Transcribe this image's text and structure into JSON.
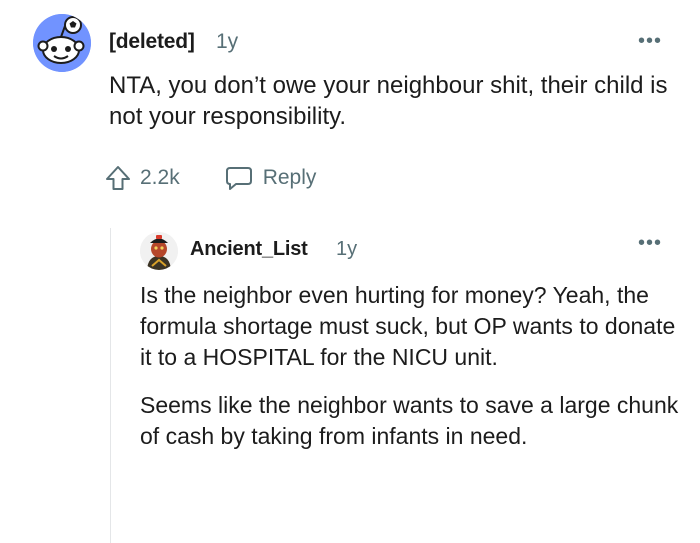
{
  "top_comment": {
    "username": "[deleted]",
    "age": "1y",
    "more_label": "•••",
    "body": "NTA, you don’t owe your neighbour shit, their child is not your responsibility.",
    "upvotes": "2.2k",
    "reply_label": "Reply"
  },
  "reply_comment": {
    "username": "Ancient_List",
    "age": "1y",
    "more_label": "•••",
    "paragraphs": [
      "Is the neighbor even hurting for money? Yeah, the formula shortage must suck, but OP wants to donate it to a HOSPITAL for the NICU unit.",
      "Seems like the neighbor wants to save a large chunk of cash by taking from infants in need."
    ]
  },
  "colors": {
    "text": "#1c1c1c",
    "meta": "#576f76",
    "default_avatar_bg": "#7193ff",
    "thread_line": "#e4e6e8"
  },
  "icons": {
    "upvote": "upvote-arrow-icon",
    "reply": "speech-bubble-icon",
    "more": "more-options-icon"
  }
}
